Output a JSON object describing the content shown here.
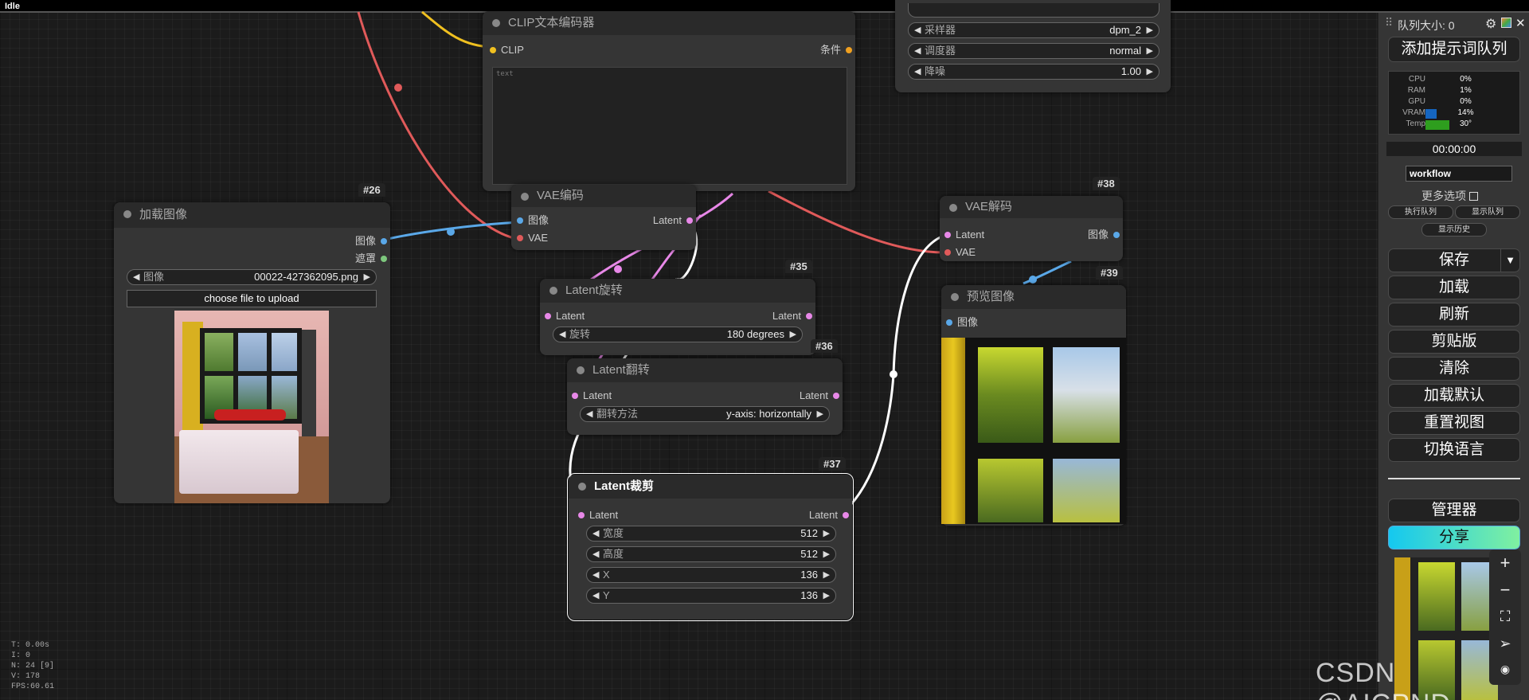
{
  "titlebar": {
    "status": "Idle"
  },
  "clip_node": {
    "title": "CLIP文本编码器",
    "in_clip": "CLIP",
    "out_cond": "条件",
    "placeholder": "text"
  },
  "sampler_node": {
    "widgets": [
      {
        "label": "采样器",
        "value": "dpm_2"
      },
      {
        "label": "调度器",
        "value": "normal"
      },
      {
        "label": "降噪",
        "value": "1.00"
      }
    ]
  },
  "load_image_node": {
    "id": "#26",
    "title": "加载图像",
    "out_image": "图像",
    "out_mask": "遮罩",
    "widget_label": "图像",
    "widget_value": "00022-427362095.png",
    "upload_label": "choose file to upload"
  },
  "vae_encode_node": {
    "title": "VAE编码",
    "in_image": "图像",
    "in_vae": "VAE",
    "out_latent": "Latent"
  },
  "rotate_node": {
    "id": "#35",
    "title": "Latent旋转",
    "in_latent": "Latent",
    "out_latent": "Latent",
    "widget_label": "旋转",
    "widget_value": "180 degrees"
  },
  "flip_node": {
    "id": "#36",
    "title": "Latent翻转",
    "in_latent": "Latent",
    "out_latent": "Latent",
    "widget_label": "翻转方法",
    "widget_value": "y-axis: horizontally"
  },
  "crop_node": {
    "id": "#37",
    "title": "Latent裁剪",
    "in_latent": "Latent",
    "out_latent": "Latent",
    "widgets": [
      {
        "label": "宽度",
        "value": "512"
      },
      {
        "label": "高度",
        "value": "512"
      },
      {
        "label": "X",
        "value": "136"
      },
      {
        "label": "Y",
        "value": "136"
      }
    ]
  },
  "vae_decode_node": {
    "id": "#38",
    "title": "VAE解码",
    "in_latent": "Latent",
    "in_vae": "VAE",
    "out_image": "图像"
  },
  "preview_node": {
    "id": "#39",
    "title": "预览图像",
    "in_image": "图像"
  },
  "sidebar": {
    "queue_label": "队列大小: 0",
    "queue_prompt": "添加提示词队列",
    "monitor": [
      {
        "label": "CPU",
        "value": "0%",
        "fill": 0.0,
        "color": "#1a1a1a"
      },
      {
        "label": "RAM",
        "value": "1%",
        "fill": 0.01,
        "color": "#1a1a1a"
      },
      {
        "label": "GPU",
        "value": "0%",
        "fill": 0.0,
        "color": "#1a1a1a"
      },
      {
        "label": "VRAM",
        "value": "14%",
        "fill": 0.14,
        "color": "#1565c0"
      },
      {
        "label": "Temp",
        "value": "30°",
        "fill": 0.3,
        "color": "#2e9e1e"
      }
    ],
    "timer": "00:00:00",
    "workflow_value": "workflow",
    "more_options": "更多选项",
    "exec_queue": "执行队列",
    "show_queue": "显示队列",
    "show_history": "显示历史",
    "save": "保存",
    "load": "加载",
    "refresh": "刷新",
    "clipspace": "剪贴版",
    "clear": "清除",
    "load_default": "加载默认",
    "reset_view": "重置视图",
    "switch_lang": "切换语言",
    "manager": "管理器",
    "share": "分享"
  },
  "stats": {
    "t": "T: 0.00s",
    "i": "I: 0",
    "n": "N: 24 [9]",
    "v": "V: 178",
    "fps": "FPS:60.61"
  },
  "watermark": "CSDN @AICPND",
  "colors": {
    "link_red": "#e05a5a",
    "link_blue": "#5aa8e8",
    "link_pink": "#e888e8",
    "link_yellow": "#f0c020",
    "link_white": "#ffffff"
  }
}
